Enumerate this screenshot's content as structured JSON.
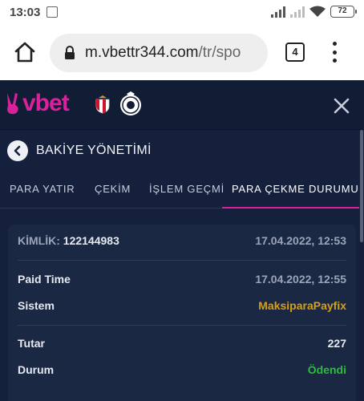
{
  "status_bar": {
    "time": "13:03",
    "battery": "72",
    "icons": [
      "gallery-icon",
      "signal-icon",
      "signal-icon",
      "wifi-icon",
      "battery-icon"
    ]
  },
  "browser": {
    "url_main": "m.vbettr344.com",
    "url_path": "/tr/spo",
    "tab_count": "4",
    "icons": [
      "home-icon",
      "lock-icon",
      "more-vert-icon"
    ]
  },
  "app": {
    "logo_text": "vbet",
    "page_title": "BAKİYE YÖNETİMİ",
    "tabs": [
      {
        "label": "PARA YATIR"
      },
      {
        "label": "ÇEKİM"
      },
      {
        "label": "İŞLEM GEÇMİ"
      },
      {
        "label": "PARA ÇEKME DURUMU"
      }
    ],
    "active_tab": 3,
    "colors": {
      "brand": "#d9219c",
      "background": "#14203c",
      "success": "#2dbb3c",
      "gold": "#d4a017"
    }
  },
  "withdrawal": {
    "id_label": "KİMLİK:",
    "id_value": "122144983",
    "created": "17.04.2022, 12:53",
    "paid_time_label": "Paid Time",
    "paid_time_value": "17.04.2022, 12:55",
    "system_label": "Sistem",
    "system_value": "MaksiparaPayfix",
    "amount_label": "Tutar",
    "amount_value": "227",
    "status_label": "Durum",
    "status_value": "Ödendi"
  }
}
